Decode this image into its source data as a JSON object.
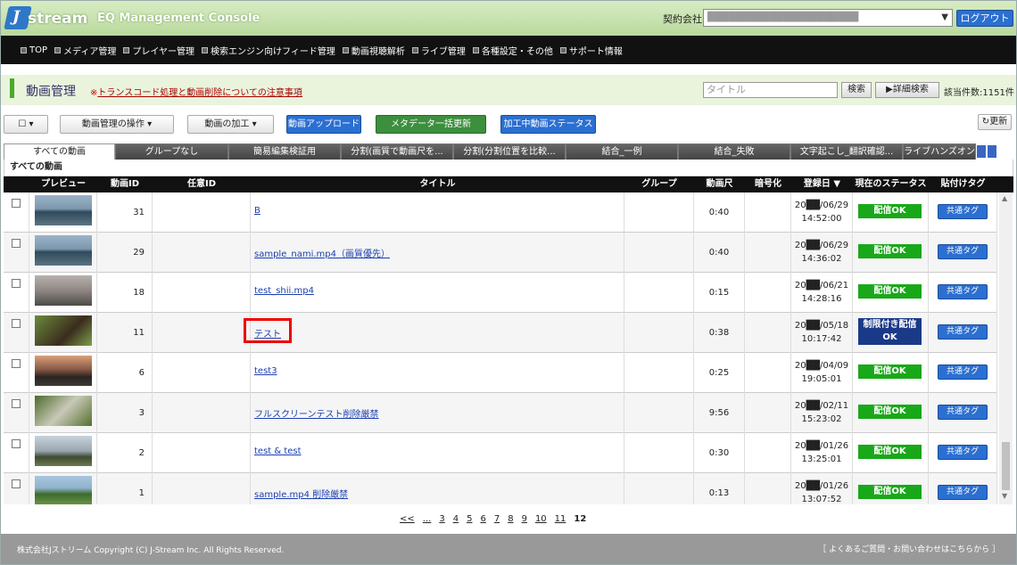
{
  "header": {
    "logo_mark": "J",
    "logo_text": "stream",
    "app_title": "EQ Management Console",
    "contract_label": "契約会社:",
    "contract_value": "██████████████████████",
    "logout_label": "ログアウト"
  },
  "nav": {
    "items": [
      "TOP",
      "メディア管理",
      "プレイヤー管理",
      "検索エンジン向けフィード管理",
      "動画視聴解析",
      "ライブ管理",
      "各種設定・その他",
      "サポート情報"
    ]
  },
  "section": {
    "title": "動画管理",
    "notice_mark": "※",
    "notice_link": "トランスコード処理と動画削除についての注意事項",
    "search_placeholder": "タイトル",
    "search_button": "検索",
    "advanced_button": "詳細検索",
    "count_text": "該当件数:1151件"
  },
  "toolbar": {
    "select_label": "☐ ▾",
    "ops_label": "動画管理の操作 ▾",
    "edit_label": "動画の加工 ▾",
    "upload_label": "動画アップロード",
    "meta_label": "メタデータ一括更新",
    "processing_label": "加工中動画ステータス",
    "refresh_label": "更新"
  },
  "tabs": [
    "すべての動画",
    "グループなし",
    "簡易編集検証用",
    "分割(画質で動画尺を...",
    "分割(分割位置を比較...",
    "結合_一例",
    "結合_失敗",
    "文字起こし_翻訳確認...",
    "ライブハンズオン"
  ],
  "subheader": "すべての動画",
  "columns": [
    "",
    "プレビュー",
    "動画ID",
    "任意ID",
    "タイトル",
    "グループ",
    "動画尺",
    "暗号化",
    "登録日 ▼",
    "現在のステータス",
    "貼付けタグ"
  ],
  "rows": [
    {
      "id": "31",
      "title": "B",
      "duration": "0:40",
      "date1": "20██/06/29",
      "date2": "14:52:00",
      "status": "配信OK",
      "tag": "共通タグ"
    },
    {
      "id": "29",
      "title": "sample_nami.mp4（画質優先）",
      "duration": "0:40",
      "date1": "20██/06/29",
      "date2": "14:36:02",
      "status": "配信OK",
      "tag": "共通タグ"
    },
    {
      "id": "18",
      "title": "test_shii.mp4",
      "duration": "0:15",
      "date1": "20██/06/21",
      "date2": "14:28:16",
      "status": "配信OK",
      "tag": "共通タグ"
    },
    {
      "id": "11",
      "title": "テスト",
      "duration": "0:38",
      "date1": "20██/05/18",
      "date2": "10:17:42",
      "status": "制限付き配信OK",
      "tag": "共通タグ"
    },
    {
      "id": "6",
      "title": "test3",
      "duration": "0:25",
      "date1": "20██/04/09",
      "date2": "19:05:01",
      "status": "配信OK",
      "tag": "共通タグ"
    },
    {
      "id": "3",
      "title": "フルスクリーンテスト削除厳禁",
      "duration": "9:56",
      "date1": "20██/02/11",
      "date2": "15:23:02",
      "status": "配信OK",
      "tag": "共通タグ"
    },
    {
      "id": "2",
      "title": "test & test",
      "duration": "0:30",
      "date1": "20██/01/26",
      "date2": "13:25:01",
      "status": "配信OK",
      "tag": "共通タグ"
    },
    {
      "id": "1",
      "title": "sample.mp4 削除厳禁",
      "duration": "0:13",
      "date1": "20██/01/26",
      "date2": "13:07:52",
      "status": "配信OK",
      "tag": "共通タグ"
    }
  ],
  "pager": [
    "<<",
    "...",
    "3",
    "4",
    "5",
    "6",
    "7",
    "8",
    "9",
    "10",
    "11",
    "12"
  ],
  "footer": {
    "copyright": "株式会社Jストリーム  Copyright (C) J-Stream Inc. All Rights Reserved.",
    "help": "［ よくあるご質問・お問い合わせはこちらから ］"
  },
  "colors": {
    "accent": "#2b6fd1",
    "ok": "#19a819",
    "limited": "#1a3a88",
    "highlight": "#e00000"
  }
}
